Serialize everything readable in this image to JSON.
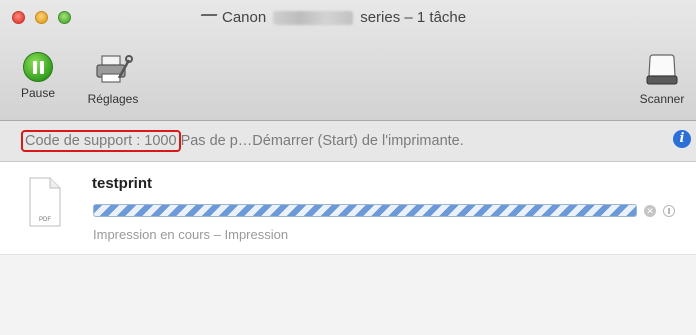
{
  "window": {
    "title_prefix": "Canon",
    "title_suffix": "series – 1 tâche"
  },
  "toolbar": {
    "pause_label": "Pause",
    "settings_label": "Réglages",
    "scanner_label": "Scanner"
  },
  "status": {
    "support_code": "Code de support : 1000",
    "message": "Pas de p…Démarrer (Start) de l'imprimante."
  },
  "job": {
    "name": "testprint",
    "file_type": "PDF",
    "status_text": "Impression en cours – Impression"
  },
  "icons": {
    "window_close": "close-icon",
    "window_minimize": "minimize-icon",
    "window_zoom": "zoom-icon",
    "title": "printer-icon",
    "pause": "pause-icon",
    "settings": "printer-settings-icon",
    "scanner": "scanner-icon",
    "info": "info-icon",
    "job_file": "pdf-file-icon",
    "job_stop": "stop-icon",
    "job_hold": "hold-icon"
  },
  "colors": {
    "highlight_border": "#d81a1a",
    "info_blue": "#2d6fd8",
    "pause_green": "#2f9a1b",
    "progress_blue": "#6c99d8"
  }
}
